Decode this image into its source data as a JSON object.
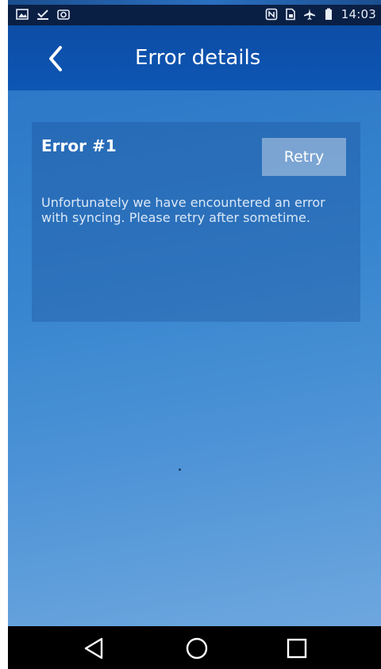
{
  "status_bar": {
    "time": "14:03",
    "left_icons": [
      "image-icon",
      "download-check-icon",
      "gallery-icon"
    ],
    "right_icons": [
      "nfc-icon",
      "sim-icon",
      "airplane-icon",
      "battery-icon"
    ]
  },
  "app_bar": {
    "title": "Error details",
    "back_icon": "chevron-left-icon"
  },
  "error_card": {
    "title": "Error #1",
    "retry_label": "Retry",
    "message": "Unfortunately we have encountered an error with syncing. Please retry after sometime."
  },
  "nav_bar": {
    "icons": [
      "back-triangle-icon",
      "home-circle-icon",
      "recents-square-icon"
    ]
  },
  "colors": {
    "app_bar": "#0d4da6",
    "status_bar": "#0a1f44",
    "content_top": "#2d78c7",
    "content_bottom": "#6ea7df",
    "nav_bar": "#000000"
  }
}
